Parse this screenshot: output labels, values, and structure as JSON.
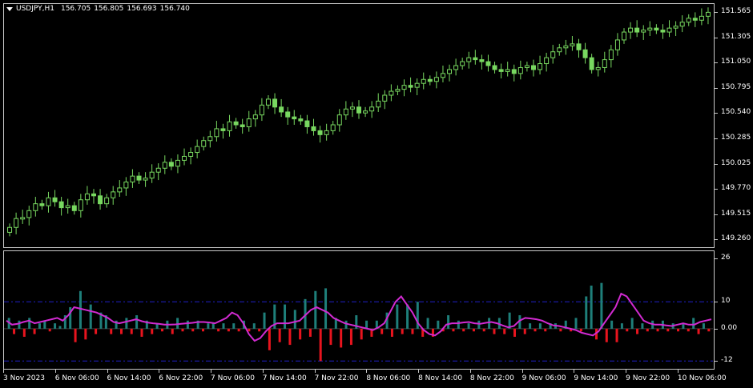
{
  "header": {
    "symbol": "USDJPY,H1",
    "open": "156.705",
    "high": "156.805",
    "low": "156.693",
    "close": "156.740"
  },
  "colors": {
    "background": "#000000",
    "bull": "#78d860",
    "bear_fill": "#000000",
    "grid_border": "#c8c8c8",
    "hist_pos": "#1e7f7a",
    "hist_neg": "#e8141e",
    "signal": "#d22ad2",
    "level": "#2020c8"
  },
  "price_axis": [
    "151.565",
    "151.305",
    "151.050",
    "150.795",
    "150.540",
    "150.285",
    "150.025",
    "149.770",
    "149.515",
    "149.260"
  ],
  "indicator_axis": [
    "26",
    "10",
    "0.00",
    "-12"
  ],
  "indicator_levels": [
    10,
    -12
  ],
  "time_axis": [
    "3 Nov 2023",
    "6 Nov 06:00",
    "6 Nov 14:00",
    "6 Nov 22:00",
    "7 Nov 06:00",
    "7 Nov 14:00",
    "7 Nov 22:00",
    "8 Nov 06:00",
    "8 Nov 14:00",
    "8 Nov 22:00",
    "9 Nov 06:00",
    "9 Nov 14:00",
    "9 Nov 22:00",
    "10 Nov 06:00"
  ],
  "chart_data": [
    {
      "type": "candlestick",
      "title": "USDJPY,H1",
      "ylim": [
        149.22,
        151.62
      ],
      "close": [
        149.38,
        149.47,
        149.48,
        149.55,
        149.62,
        149.6,
        149.68,
        149.64,
        149.58,
        149.6,
        149.55,
        149.66,
        149.72,
        149.7,
        149.62,
        149.68,
        149.74,
        149.78,
        149.84,
        149.9,
        149.86,
        149.88,
        149.94,
        149.98,
        150.04,
        150.0,
        150.06,
        150.1,
        150.14,
        150.2,
        150.26,
        150.3,
        150.38,
        150.36,
        150.45,
        150.42,
        150.4,
        150.48,
        150.52,
        150.62,
        150.68,
        150.6,
        150.55,
        150.5,
        150.48,
        150.46,
        150.4,
        150.36,
        150.32,
        150.36,
        150.42,
        150.52,
        150.58,
        150.6,
        150.54,
        150.56,
        150.6,
        150.66,
        150.72,
        150.76,
        150.78,
        150.82,
        150.8,
        150.84,
        150.88,
        150.86,
        150.9,
        150.94,
        150.98,
        151.02,
        151.06,
        151.1,
        151.08,
        151.06,
        151.02,
        150.98,
        150.96,
        150.98,
        150.94,
        151.0,
        151.02,
        150.98,
        151.04,
        151.1,
        151.16,
        151.2,
        151.22,
        151.24,
        151.18,
        151.1,
        150.98,
        151.0,
        151.08,
        151.18,
        151.28,
        151.36,
        151.4,
        151.36,
        151.38,
        151.4,
        151.38,
        151.36,
        151.4,
        151.42,
        151.46,
        151.5,
        151.48,
        151.52,
        151.56
      ],
      "bull_up": [
        1,
        1,
        1,
        1,
        1,
        0,
        1,
        0,
        0,
        1,
        0,
        1,
        1,
        0,
        0,
        1,
        1,
        1,
        1,
        1,
        0,
        1,
        1,
        1,
        1,
        0,
        1,
        1,
        1,
        1,
        1,
        1,
        1,
        0,
        1,
        0,
        0,
        1,
        1,
        1,
        1,
        0,
        0,
        0,
        0,
        0,
        0,
        0,
        0,
        1,
        1,
        1,
        1,
        1,
        0,
        1,
        1,
        1,
        1,
        1,
        1,
        1,
        0,
        1,
        1,
        0,
        1,
        1,
        1,
        1,
        1,
        1,
        0,
        0,
        0,
        0,
        0,
        1,
        0,
        1,
        1,
        0,
        1,
        1,
        1,
        1,
        1,
        1,
        0,
        0,
        0,
        1,
        1,
        1,
        1,
        1,
        1,
        0,
        1,
        1,
        0,
        0,
        1,
        1,
        1,
        1,
        0,
        1,
        1
      ],
      "histogram": [
        4,
        -2,
        3,
        -3,
        4,
        -2,
        2,
        3,
        -1,
        2,
        1,
        5,
        8,
        -5,
        14,
        -4,
        9,
        -2,
        6,
        5,
        -2,
        3,
        -2,
        4,
        -2,
        5,
        -3,
        3,
        -2,
        2,
        -1,
        3,
        -2,
        4,
        -1,
        3,
        -1,
        3,
        -1,
        2,
        2,
        -1,
        2,
        -1,
        2,
        -1,
        3,
        -1,
        2,
        -1,
        6,
        -8,
        9,
        -5,
        9,
        -6,
        7,
        -4,
        11,
        -3,
        14,
        -12,
        15,
        -6,
        4,
        -7,
        3,
        -6,
        5,
        -4,
        3,
        -3,
        3,
        -2,
        6,
        -3,
        9,
        -2,
        9,
        -2,
        10,
        -3,
        4,
        -3,
        3,
        -1,
        5,
        -1,
        3,
        -1,
        2,
        -1,
        3,
        -1,
        4,
        -2,
        4,
        -2,
        6,
        -3,
        5,
        -2,
        2,
        -1,
        2,
        -1,
        2,
        2,
        -1,
        3,
        -1,
        4,
        -1,
        12,
        16,
        -4,
        17,
        -5,
        3,
        -5,
        2,
        -1,
        4,
        -2,
        2,
        -1,
        3,
        -1,
        3,
        -1,
        2,
        -1,
        2,
        -1,
        4,
        -2,
        2,
        -1
      ],
      "signal": [
        3,
        1.5,
        1.8,
        2.5,
        3,
        2,
        2.5,
        3,
        3.5,
        4,
        3,
        5,
        8,
        7.5,
        7,
        6.5,
        6,
        5,
        4,
        2.5,
        2,
        2.5,
        3,
        3.5,
        2.8,
        2.3,
        2,
        1.8,
        1.5,
        1.5,
        1.6,
        1.8,
        2,
        2.2,
        2.5,
        2.5,
        2.3,
        2,
        3,
        4,
        6,
        5,
        2,
        -2,
        -4.5,
        -3.5,
        -1,
        1,
        2,
        2,
        2,
        2.5,
        3,
        5,
        7,
        8,
        7,
        6,
        4,
        3,
        2,
        1.5,
        1,
        0.5,
        0,
        -0.5,
        0.5,
        2,
        6,
        10,
        12,
        9,
        6,
        2,
        -0.5,
        -2,
        -2.5,
        -1,
        1.5,
        2,
        2,
        2.3,
        2.5,
        2,
        1.8,
        2.2,
        2.5,
        2,
        1.2,
        0.5,
        1,
        3,
        4,
        3.8,
        3.5,
        3,
        2,
        1.2,
        1,
        0.5,
        0,
        -0.5,
        -1.5,
        -2,
        -2.5,
        -1,
        2,
        5,
        8,
        13,
        12,
        9,
        6,
        3,
        2,
        1.5,
        1.5,
        1.2,
        1,
        1.5,
        2,
        1.5,
        1.5,
        2.5,
        3,
        3.5
      ]
    }
  ]
}
